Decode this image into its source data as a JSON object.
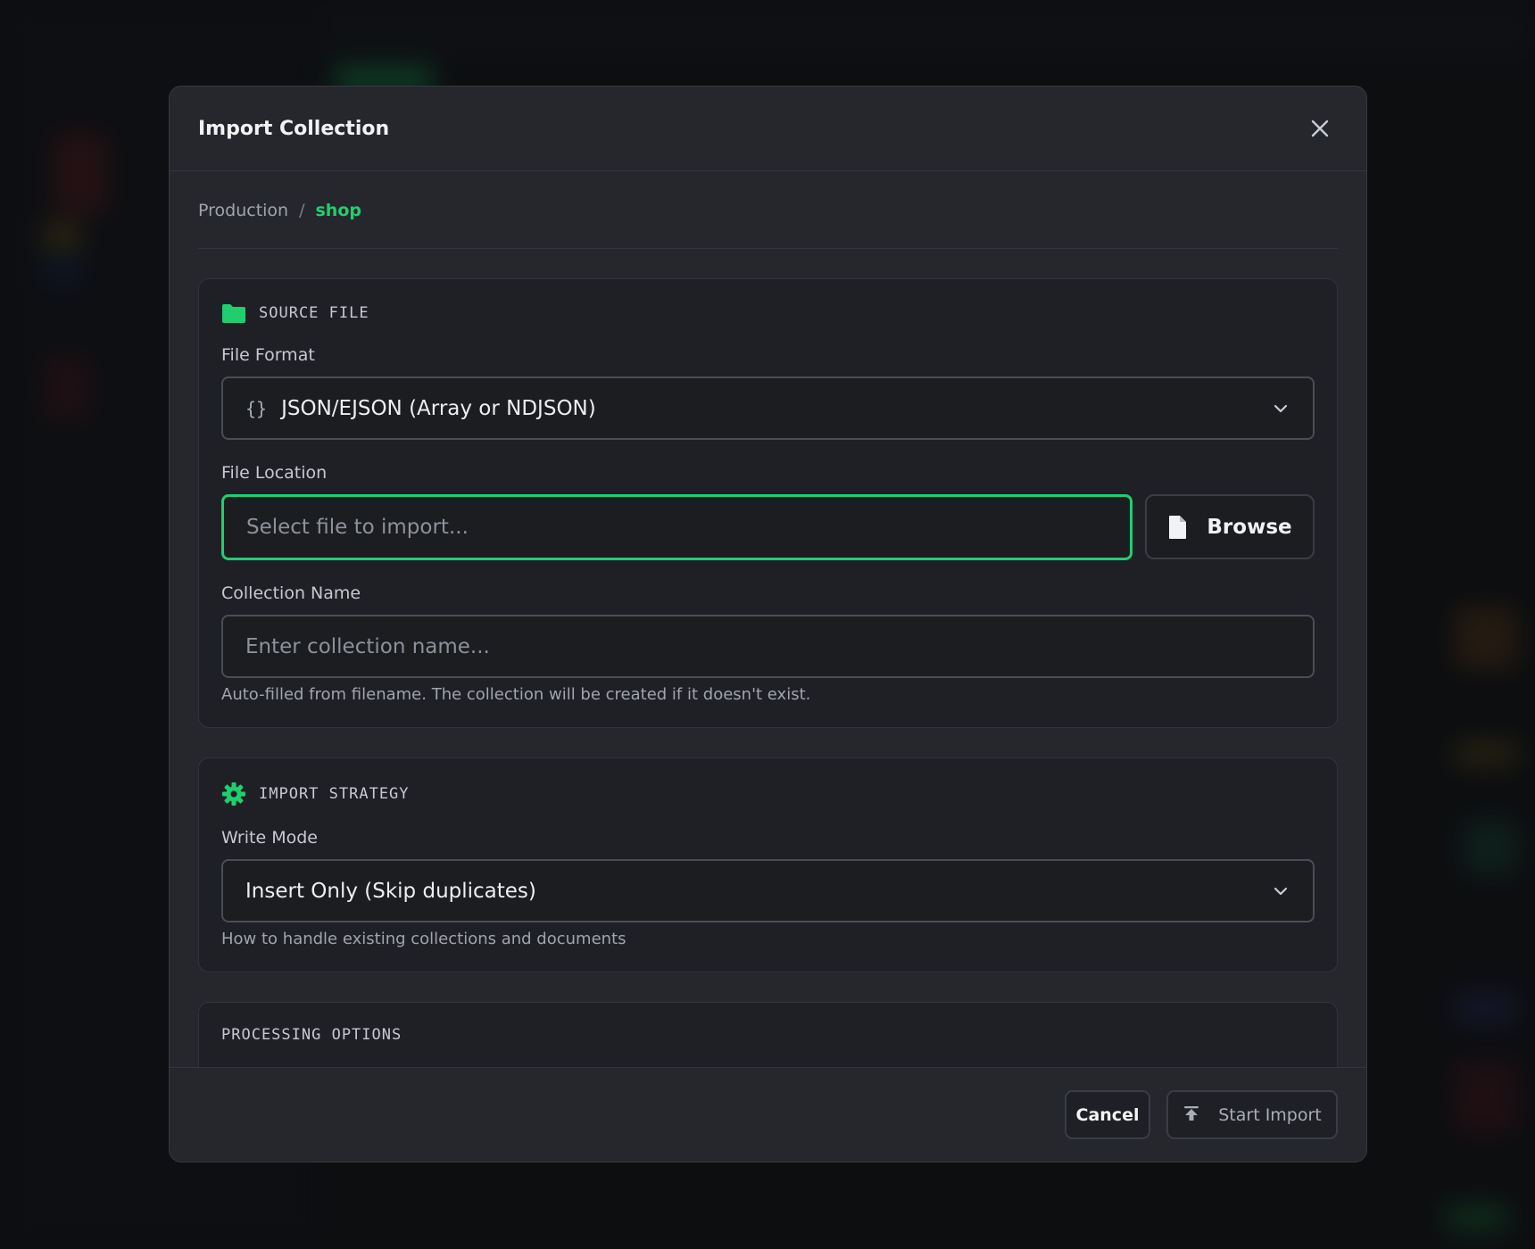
{
  "modal": {
    "title": "Import Collection",
    "close_icon": "close-icon"
  },
  "breadcrumb": {
    "connection": "Production",
    "separator": "/",
    "database": "shop"
  },
  "source_file": {
    "section_title": "SOURCE FILE",
    "icon": "folder-icon",
    "file_format_label": "File Format",
    "file_format_icon": "{}",
    "file_format_value": "JSON/EJSON (Array or NDJSON)",
    "file_location_label": "File Location",
    "file_location_placeholder": "Select file to import...",
    "browse_label": "Browse",
    "collection_name_label": "Collection Name",
    "collection_name_placeholder": "Enter collection name...",
    "collection_name_hint": "Auto-filled from filename. The collection will be created if it doesn't exist."
  },
  "import_strategy": {
    "section_title": "IMPORT STRATEGY",
    "icon": "gear-icon",
    "write_mode_label": "Write Mode",
    "write_mode_value": "Insert Only (Skip duplicates)",
    "write_mode_hint": "How to handle existing collections and documents"
  },
  "processing_options": {
    "section_title": "PROCESSING OPTIONS"
  },
  "footer": {
    "cancel_label": "Cancel",
    "start_label": "Start Import"
  },
  "colors": {
    "accent": "#1fcf6e",
    "modal_bg": "#25272d",
    "card_bg": "#1f2025"
  }
}
